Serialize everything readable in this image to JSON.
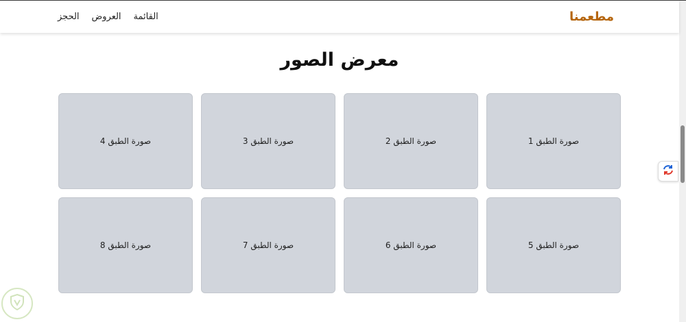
{
  "header": {
    "logo": "مطعمنا",
    "nav": [
      "القائمة",
      "العروض",
      "الحجز"
    ]
  },
  "main": {
    "title": "معرض الصور",
    "gallery": [
      "صورة الطبق 1",
      "صورة الطبق 2",
      "صورة الطبق 3",
      "صورة الطبق 4",
      "صورة الطبق 5",
      "صورة الطبق 6",
      "صورة الطبق 7",
      "صورة الطبق 8"
    ]
  },
  "colors": {
    "brand": "#b5650d",
    "card_bg": "#d1d5dc",
    "text": "#111111"
  },
  "icons": {
    "floating": "sync-arrows-icon",
    "watermark": "shield-icon"
  }
}
